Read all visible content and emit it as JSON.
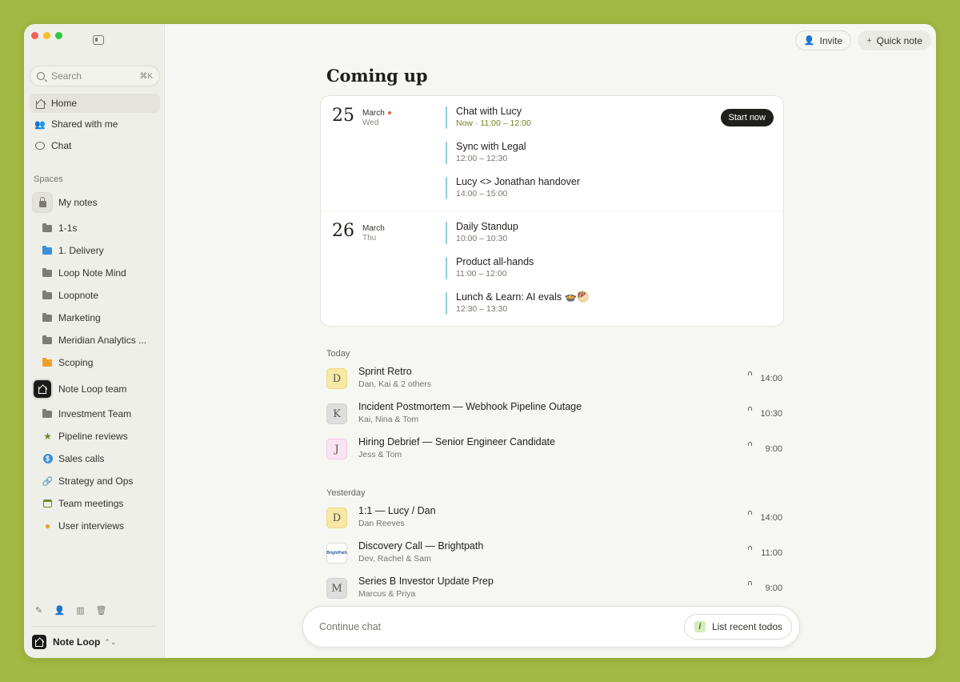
{
  "sidebar": {
    "search": {
      "label": "Search",
      "shortcut": "⌘K"
    },
    "nav": [
      {
        "label": "Home"
      },
      {
        "label": "Shared with me"
      },
      {
        "label": "Chat"
      }
    ],
    "spaces_label": "Spaces",
    "my_notes": {
      "label": "My notes",
      "folders": [
        "1-1s",
        "1. Delivery",
        "Loop Note Mind",
        "Loopnote",
        "Marketing",
        "Meridian Analytics ...",
        "Scoping"
      ]
    },
    "team": {
      "label": "Note Loop team",
      "items": [
        "Investment Team",
        "Pipeline reviews",
        "Sales calls",
        "Strategy and Ops",
        "Team meetings",
        "User interviews"
      ]
    },
    "workspace": "Note Loop"
  },
  "header": {
    "invite_label": "Invite",
    "quick_note_label": "Quick note"
  },
  "coming_up": {
    "title": "Coming up",
    "start_now_label": "Start now",
    "days": [
      {
        "day": "25",
        "month": "March",
        "weekday": "Wed",
        "events": [
          {
            "title": "Chat with Lucy",
            "time": "Now · 11:00 – 12:00"
          },
          {
            "title": "Sync with Legal",
            "time": "12:00 – 12:30"
          },
          {
            "title": "Lucy <> Jonathan handover",
            "time": "14:00 – 15:00"
          }
        ]
      },
      {
        "day": "26",
        "month": "March",
        "weekday": "Thu",
        "events": [
          {
            "title": "Daily Standup",
            "time": "10:00 – 10:30"
          },
          {
            "title": "Product all-hands",
            "time": "11:00 – 12:00"
          },
          {
            "title": "Lunch & Learn: AI evals 🍲🥙",
            "time": "12:30 – 13:30"
          }
        ]
      }
    ]
  },
  "groups": [
    {
      "label": "Today",
      "notes": [
        {
          "avatar": "D",
          "title": "Sprint Retro",
          "people": "Dan, Kai & 2 others",
          "time": "14:00"
        },
        {
          "avatar": "K",
          "title": "Incident Postmortem — Webhook Pipeline Outage",
          "people": "Kai, Nina & Tom",
          "time": "10:30"
        },
        {
          "avatar": "J",
          "title": "Hiring Debrief — Senior Engineer Candidate",
          "people": "Jess & Tom",
          "time": "9:00"
        }
      ]
    },
    {
      "label": "Yesterday",
      "notes": [
        {
          "avatar": "D",
          "title": "1:1 — Lucy / Dan",
          "people": "Dan Reeves",
          "time": "14:00"
        },
        {
          "avatar": "BrightPath",
          "title": "Discovery Call — Brightpath",
          "people": "Dev, Rachel & Sam",
          "time": "11:00"
        },
        {
          "avatar": "M",
          "title": "Series B Investor Update Prep",
          "people": "Marcus & Priya",
          "time": "9:00"
        }
      ]
    }
  ],
  "chat": {
    "placeholder": "Continue chat",
    "todo_shortcut": "/",
    "todo_label": "List recent todos"
  }
}
